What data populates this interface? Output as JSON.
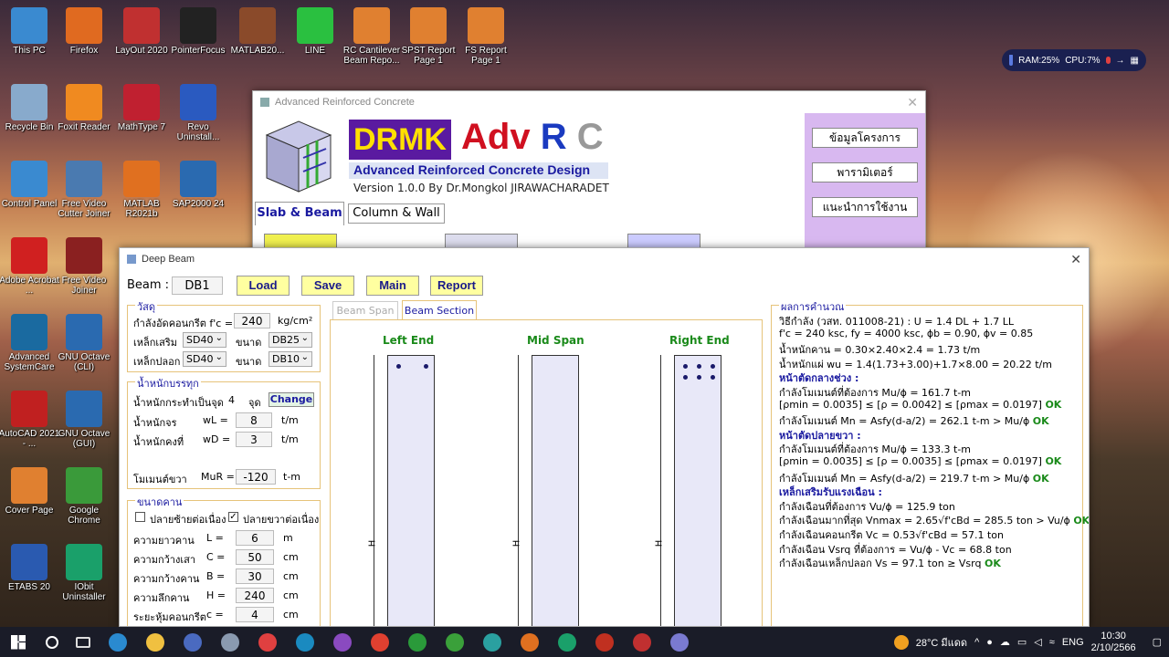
{
  "desktop_icons": [
    {
      "label": "This PC",
      "color": "#3a8ad0"
    },
    {
      "label": "Firefox",
      "color": "#e06a20"
    },
    {
      "label": "LayOut 2020",
      "color": "#c03030"
    },
    {
      "label": "PointerFocus",
      "color": "#222"
    },
    {
      "label": "MATLAB20...",
      "color": "#8a4a2a"
    },
    {
      "label": "LINE",
      "color": "#2ac040"
    },
    {
      "label": "RC Cantilever Beam Repo...",
      "color": "#e08030"
    },
    {
      "label": "SPST Report Page 1",
      "color": "#e08030"
    },
    {
      "label": "FS Report Page 1",
      "color": "#e08030"
    },
    {
      "label": "Recycle Bin",
      "color": "#88aacc"
    },
    {
      "label": "Foxit Reader",
      "color": "#f08a20"
    },
    {
      "label": "MathType 7",
      "color": "#c02030"
    },
    {
      "label": "Revo Uninstall...",
      "color": "#2a5ac0"
    },
    {
      "label": "Control Panel",
      "color": "#3a8ad0"
    },
    {
      "label": "Free Video Cutter Joiner",
      "color": "#4a7ab0"
    },
    {
      "label": "MATLAB R2021b",
      "color": "#e07020"
    },
    {
      "label": "SAP2000 24",
      "color": "#2a6ab0"
    },
    {
      "label": "Adobe Acrobat ...",
      "color": "#d02020"
    },
    {
      "label": "Free Video Joiner",
      "color": "#8a2020"
    },
    {
      "label": "Advanced SystemCare",
      "color": "#1a6aa0"
    },
    {
      "label": "GNU Octave (CLI)",
      "color": "#2a6ab0"
    },
    {
      "label": "AutoCAD 2021 - ...",
      "color": "#c02020"
    },
    {
      "label": "GNU Octave (GUI)",
      "color": "#2a6ab0"
    },
    {
      "label": "Cover Page",
      "color": "#e08030"
    },
    {
      "label": "Google Chrome",
      "color": "#3a9a3a"
    },
    {
      "label": "ETABS 20",
      "color": "#2a5ab0"
    },
    {
      "label": "IObit Uninstaller",
      "color": "#1aa06a"
    }
  ],
  "perf": {
    "ram": "RAM:25%",
    "cpu": "CPU:7%"
  },
  "main_window": {
    "title": "Advanced Reinforced Concrete",
    "logo_drmk": "DRMK",
    "logo_adv": "Adv",
    "logo_r": "R",
    "logo_c": "C",
    "subtitle": "Advanced Reinforced Concrete Design",
    "version": "Version 1.0.0  By Dr.Mongkol JIRAWACHARADET",
    "tabs": [
      "Slab & Beam",
      "Column & Wall"
    ],
    "side_buttons": [
      "ข้อมูลโครงการ",
      "พารามิเตอร์",
      "แนะนำการใช้งาน"
    ]
  },
  "deep_beam": {
    "title": "Deep Beam",
    "beam_label": "Beam :",
    "beam_value": "DB1",
    "buttons": {
      "load": "Load",
      "save": "Save",
      "main": "Main",
      "report": "Report"
    },
    "material": {
      "title": "วัสดุ",
      "fc_label": "กำลังอัดคอนกรีต f'c =",
      "fc_value": "240",
      "fc_unit": "kg/cm²",
      "main_label": "เหล็กเสริม",
      "main_value": "SD40",
      "size_label": "ขนาด",
      "main_size": "DB25",
      "stirrup_label": "เหล็กปลอก",
      "stirrup_value": "SD40",
      "stirrup_size": "DB10"
    },
    "loads": {
      "title": "น้ำหนักบรรทุก",
      "point_label": "น้ำหนักกระทำเป็นจุด",
      "point_count": "4",
      "point_unit": "จุด",
      "change": "Change",
      "live_label": "น้ำหนักจร",
      "live_sym": "wL =",
      "live_value": "8",
      "live_unit": "t/m",
      "dead_label": "น้ำหนักคงที่",
      "dead_sym": "wD =",
      "dead_value": "3",
      "dead_unit": "t/m",
      "moment_label": "โมเมนต์ขวา",
      "moment_sym": "MuR =",
      "moment_value": "-120",
      "moment_unit": "t-m"
    },
    "dims": {
      "title": "ขนาดคาน",
      "left_cont": "ปลายซ้ายต่อเนื่อง",
      "right_cont": "ปลายขวาต่อเนื่อง",
      "rows": [
        {
          "label": "ความยาวคาน",
          "sym": "L =",
          "value": "6",
          "unit": "m"
        },
        {
          "label": "ความกว้างเสา",
          "sym": "C =",
          "value": "50",
          "unit": "cm"
        },
        {
          "label": "ความกว้างคาน",
          "sym": "B =",
          "value": "30",
          "unit": "cm"
        },
        {
          "label": "ความลึกคาน",
          "sym": "H =",
          "value": "240",
          "unit": "cm"
        },
        {
          "label": "ระยะหุ้มคอนกรีต",
          "sym": "c =",
          "value": "4",
          "unit": "cm"
        }
      ]
    },
    "section_tabs": [
      "Beam Span",
      "Beam Section"
    ],
    "sections": [
      "Left End",
      "Mid Span",
      "Right End"
    ],
    "results": {
      "title": "ผลการคำนวณ",
      "lines": [
        {
          "t": "วิธีกำลัง (วสท. 011008-21) : U = 1.4 DL + 1.7 LL",
          "ok": ""
        },
        {
          "t": "f'c = 240 ksc, fy = 4000 ksc, ϕb = 0.90, ϕv = 0.85",
          "ok": ""
        },
        {
          "t": "น้ำหนักคาน = 0.30×2.40×2.4 = 1.73 t/m",
          "ok": ""
        },
        {
          "t": "น้ำหนักแผ่ wu = 1.4(1.73+3.00)+1.7×8.00 = 20.22 t/m",
          "ok": ""
        },
        {
          "t": "หน้าตัดกลางช่วง :",
          "ok": "",
          "h": true
        },
        {
          "t": "  กำลังโมเมนต์ที่ต้องการ  Mu/ϕ  =  161.7 t-m",
          "ok": ""
        },
        {
          "t": "  [ρmin = 0.0035] ≤ [ρ = 0.0042] ≤ [ρmax = 0.0197]",
          "ok": "OK"
        },
        {
          "t": "  กำลังโมเมนต์  Mn  =  Asfy(d-a/2)  =  262.1 t-m  >  Mu/ϕ",
          "ok": "OK"
        },
        {
          "t": "หน้าตัดปลายขวา :",
          "ok": "",
          "h": true
        },
        {
          "t": "  กำลังโมเมนต์ที่ต้องการ  Mu/ϕ  =  133.3 t-m",
          "ok": ""
        },
        {
          "t": "  [ρmin = 0.0035] ≤ [ρ = 0.0035] ≤ [ρmax = 0.0197]",
          "ok": "OK"
        },
        {
          "t": "  กำลังโมเมนต์  Mn  =  Asfy(d-a/2)  =  219.7 t-m  >  Mu/ϕ",
          "ok": "OK"
        },
        {
          "t": "เหล็กเสริมรับแรงเฉือน :",
          "ok": "",
          "h": true
        },
        {
          "t": "  กำลังเฉือนที่ต้องการ  Vu/ϕ  =  125.9 ton",
          "ok": ""
        },
        {
          "t": "  กำลังเฉือนมากที่สุด  Vnmax  =  2.65√f'cBd  =  285.5 ton > Vu/ϕ",
          "ok": "OK"
        },
        {
          "t": "  กำลังเฉือนคอนกรีต  Vc  =  0.53√f'cBd  =  57.1 ton",
          "ok": ""
        },
        {
          "t": "  กำลังเฉือน Vsrq ที่ต้องการ  =  Vu/ϕ - Vc  =  68.8 ton",
          "ok": ""
        },
        {
          "t": "  กำลังเฉือนเหล็กปลอก  Vs  =  97.1 ton  ≥  Vsrq",
          "ok": "OK"
        }
      ]
    }
  },
  "taskbar": {
    "weather": "28°C  มีแดด",
    "lang": "ENG",
    "time": "10:30",
    "date": "2/10/2566"
  }
}
